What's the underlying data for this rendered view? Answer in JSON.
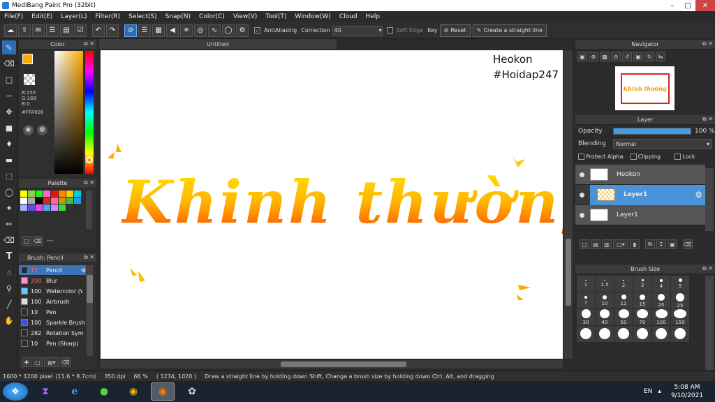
{
  "window": {
    "title": "MediBang Paint Pro (32bit)"
  },
  "menu": [
    "File(F)",
    "Edit(E)",
    "Layer(L)",
    "Filter(R)",
    "Select(S)",
    "Snap(N)",
    "Color(C)",
    "View(V)",
    "Tool(T)",
    "Window(W)",
    "Cloud",
    "Help"
  ],
  "toolbar": {
    "antialiasing_label": "AntiAliasing",
    "correction_label": "Correction",
    "correction_value": "40",
    "soft_edge_label": "Soft Edge",
    "key_label": "Key",
    "reset_label": "Reset",
    "straight_line_label": "Create a straight line"
  },
  "color_panel": {
    "title": "Color",
    "r": "R:255",
    "g": "G:169",
    "b": "B:0",
    "hex": "#FFA900",
    "fg_color": "#ffa900"
  },
  "palette_panel": {
    "title": "Palette",
    "footer_text": "---",
    "swatches": [
      "#fefe00",
      "#8ed04c",
      "#22ee22",
      "#ff66cc",
      "#ee1111",
      "#ff8800",
      "#ffcc00",
      "#00ccdd",
      "#ffffff",
      "#aaaaaa",
      "#000000",
      "#dd2222",
      "#ff6699",
      "#cc9900",
      "#44bb44",
      "#2299ee",
      "#aaaaff",
      "#5555dd",
      "#ee44ee",
      "#44aaee",
      "#cc88ff",
      "#33dd33",
      "#333333",
      "#2d2d2d"
    ]
  },
  "brush_panel": {
    "title": "Brush: Pencil",
    "brushes": [
      {
        "size": "15",
        "name": "Pencil",
        "color": "#2b2b2b"
      },
      {
        "size": "200",
        "name": "Blur",
        "color": "#ff8fd6"
      },
      {
        "size": "100",
        "name": "Watercolor (W",
        "color": "#5bd0ff"
      },
      {
        "size": "100",
        "name": "Airbrush",
        "color": "#dddddd"
      },
      {
        "size": "10",
        "name": "Pen",
        "color": "#2b2b2b"
      },
      {
        "size": "100",
        "name": "Sparkle Brush",
        "color": "#3b55d6"
      },
      {
        "size": "282",
        "name": "Rotation Sym",
        "color": "#2b2b2b"
      },
      {
        "size": "10",
        "name": "Pen (Sharp)",
        "color": "#2b2b2b"
      }
    ]
  },
  "document": {
    "tab_title": "Untitled",
    "watermark_line1": "Heokon",
    "watermark_line2": "#Hoidap247",
    "artwork_text": "Khinh thường"
  },
  "navigator": {
    "title": "Navigator",
    "thumb_text": "Khinh thường"
  },
  "layer_panel": {
    "title": "Layer",
    "opacity_label": "Opacity",
    "opacity_value": "100 %",
    "opacity_fraction": 1.0,
    "blending_label": "Blending",
    "blending_value": "Normal",
    "protect_alpha_label": "Protect Alpha",
    "clipping_label": "Clipping",
    "lock_label": "Lock",
    "layers": [
      {
        "name": "Heokon",
        "selected": false
      },
      {
        "name": "Layer1",
        "selected": true
      },
      {
        "name": "Layer1",
        "selected": false
      }
    ]
  },
  "brush_size_panel": {
    "title": "Brush Size",
    "sizes": [
      "1",
      "1.5",
      "2",
      "3",
      "4",
      "5",
      "7",
      "10",
      "12",
      "15",
      "20",
      "25",
      "30",
      "40",
      "50",
      "70",
      "100",
      "150",
      "",
      "",
      "",
      "",
      "",
      ""
    ]
  },
  "status": {
    "canvas_size": "1600 * 1200 pixel",
    "physical_size": "(11.6 * 8.7cm)",
    "dpi": "350 dpi",
    "zoom": "66 %",
    "cursor": "( 1234, 1020 )",
    "hint": "Draw a straight line by holding down Shift, Change a brush size by holding down Ctrl, Alt, and dragging"
  },
  "taskbar": {
    "language": "EN",
    "time": "5:08 AM",
    "date": "9/10/2021"
  }
}
